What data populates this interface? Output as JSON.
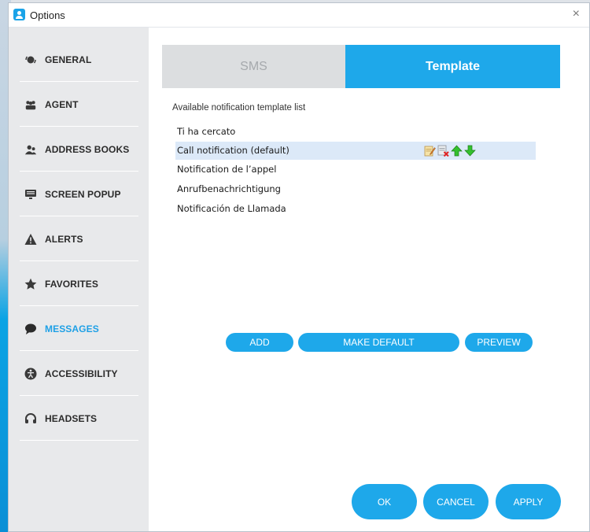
{
  "window": {
    "title": "Options",
    "close_glyph": "×"
  },
  "sidebar": {
    "items": [
      {
        "label": "GENERAL",
        "icon": "general-icon",
        "active": false
      },
      {
        "label": "AGENT",
        "icon": "agent-icon",
        "active": false
      },
      {
        "label": "ADDRESS BOOKS",
        "icon": "address-books-icon",
        "active": false
      },
      {
        "label": "SCREEN POPUP",
        "icon": "screen-popup-icon",
        "active": false
      },
      {
        "label": "ALERTS",
        "icon": "alerts-icon",
        "active": false
      },
      {
        "label": "FAVORITES",
        "icon": "star-icon",
        "active": false
      },
      {
        "label": "MESSAGES",
        "icon": "message-bubble-icon",
        "active": true
      },
      {
        "label": "ACCESSIBILITY",
        "icon": "accessibility-icon",
        "active": false
      },
      {
        "label": "HEADSETS",
        "icon": "headset-icon",
        "active": false
      }
    ]
  },
  "tabs": [
    {
      "label": "SMS",
      "active": false
    },
    {
      "label": "Template",
      "active": true
    }
  ],
  "templates": {
    "heading": "Available notification template list",
    "items": [
      {
        "label": "Ti ha cercato",
        "selected": false
      },
      {
        "label": "Call notification (default)",
        "selected": true
      },
      {
        "label": "Notification de l’appel",
        "selected": false
      },
      {
        "label": "Anrufbenachrichtigung",
        "selected": false
      },
      {
        "label": "Notificación de Llamada",
        "selected": false
      }
    ],
    "row_actions": [
      "edit-icon",
      "delete-icon",
      "move-up-icon",
      "move-down-icon"
    ]
  },
  "actions": {
    "add": "ADD",
    "make_default": "MAKE DEFAULT",
    "preview": "PREVIEW"
  },
  "footer": {
    "ok": "OK",
    "cancel": "CANCEL",
    "apply": "APPLY"
  },
  "colors": {
    "accent": "#1ea8ea",
    "active_nav": "#1ea0e6",
    "selected_row": "#dce9f8",
    "sidebar_bg": "#e8e9eb"
  }
}
